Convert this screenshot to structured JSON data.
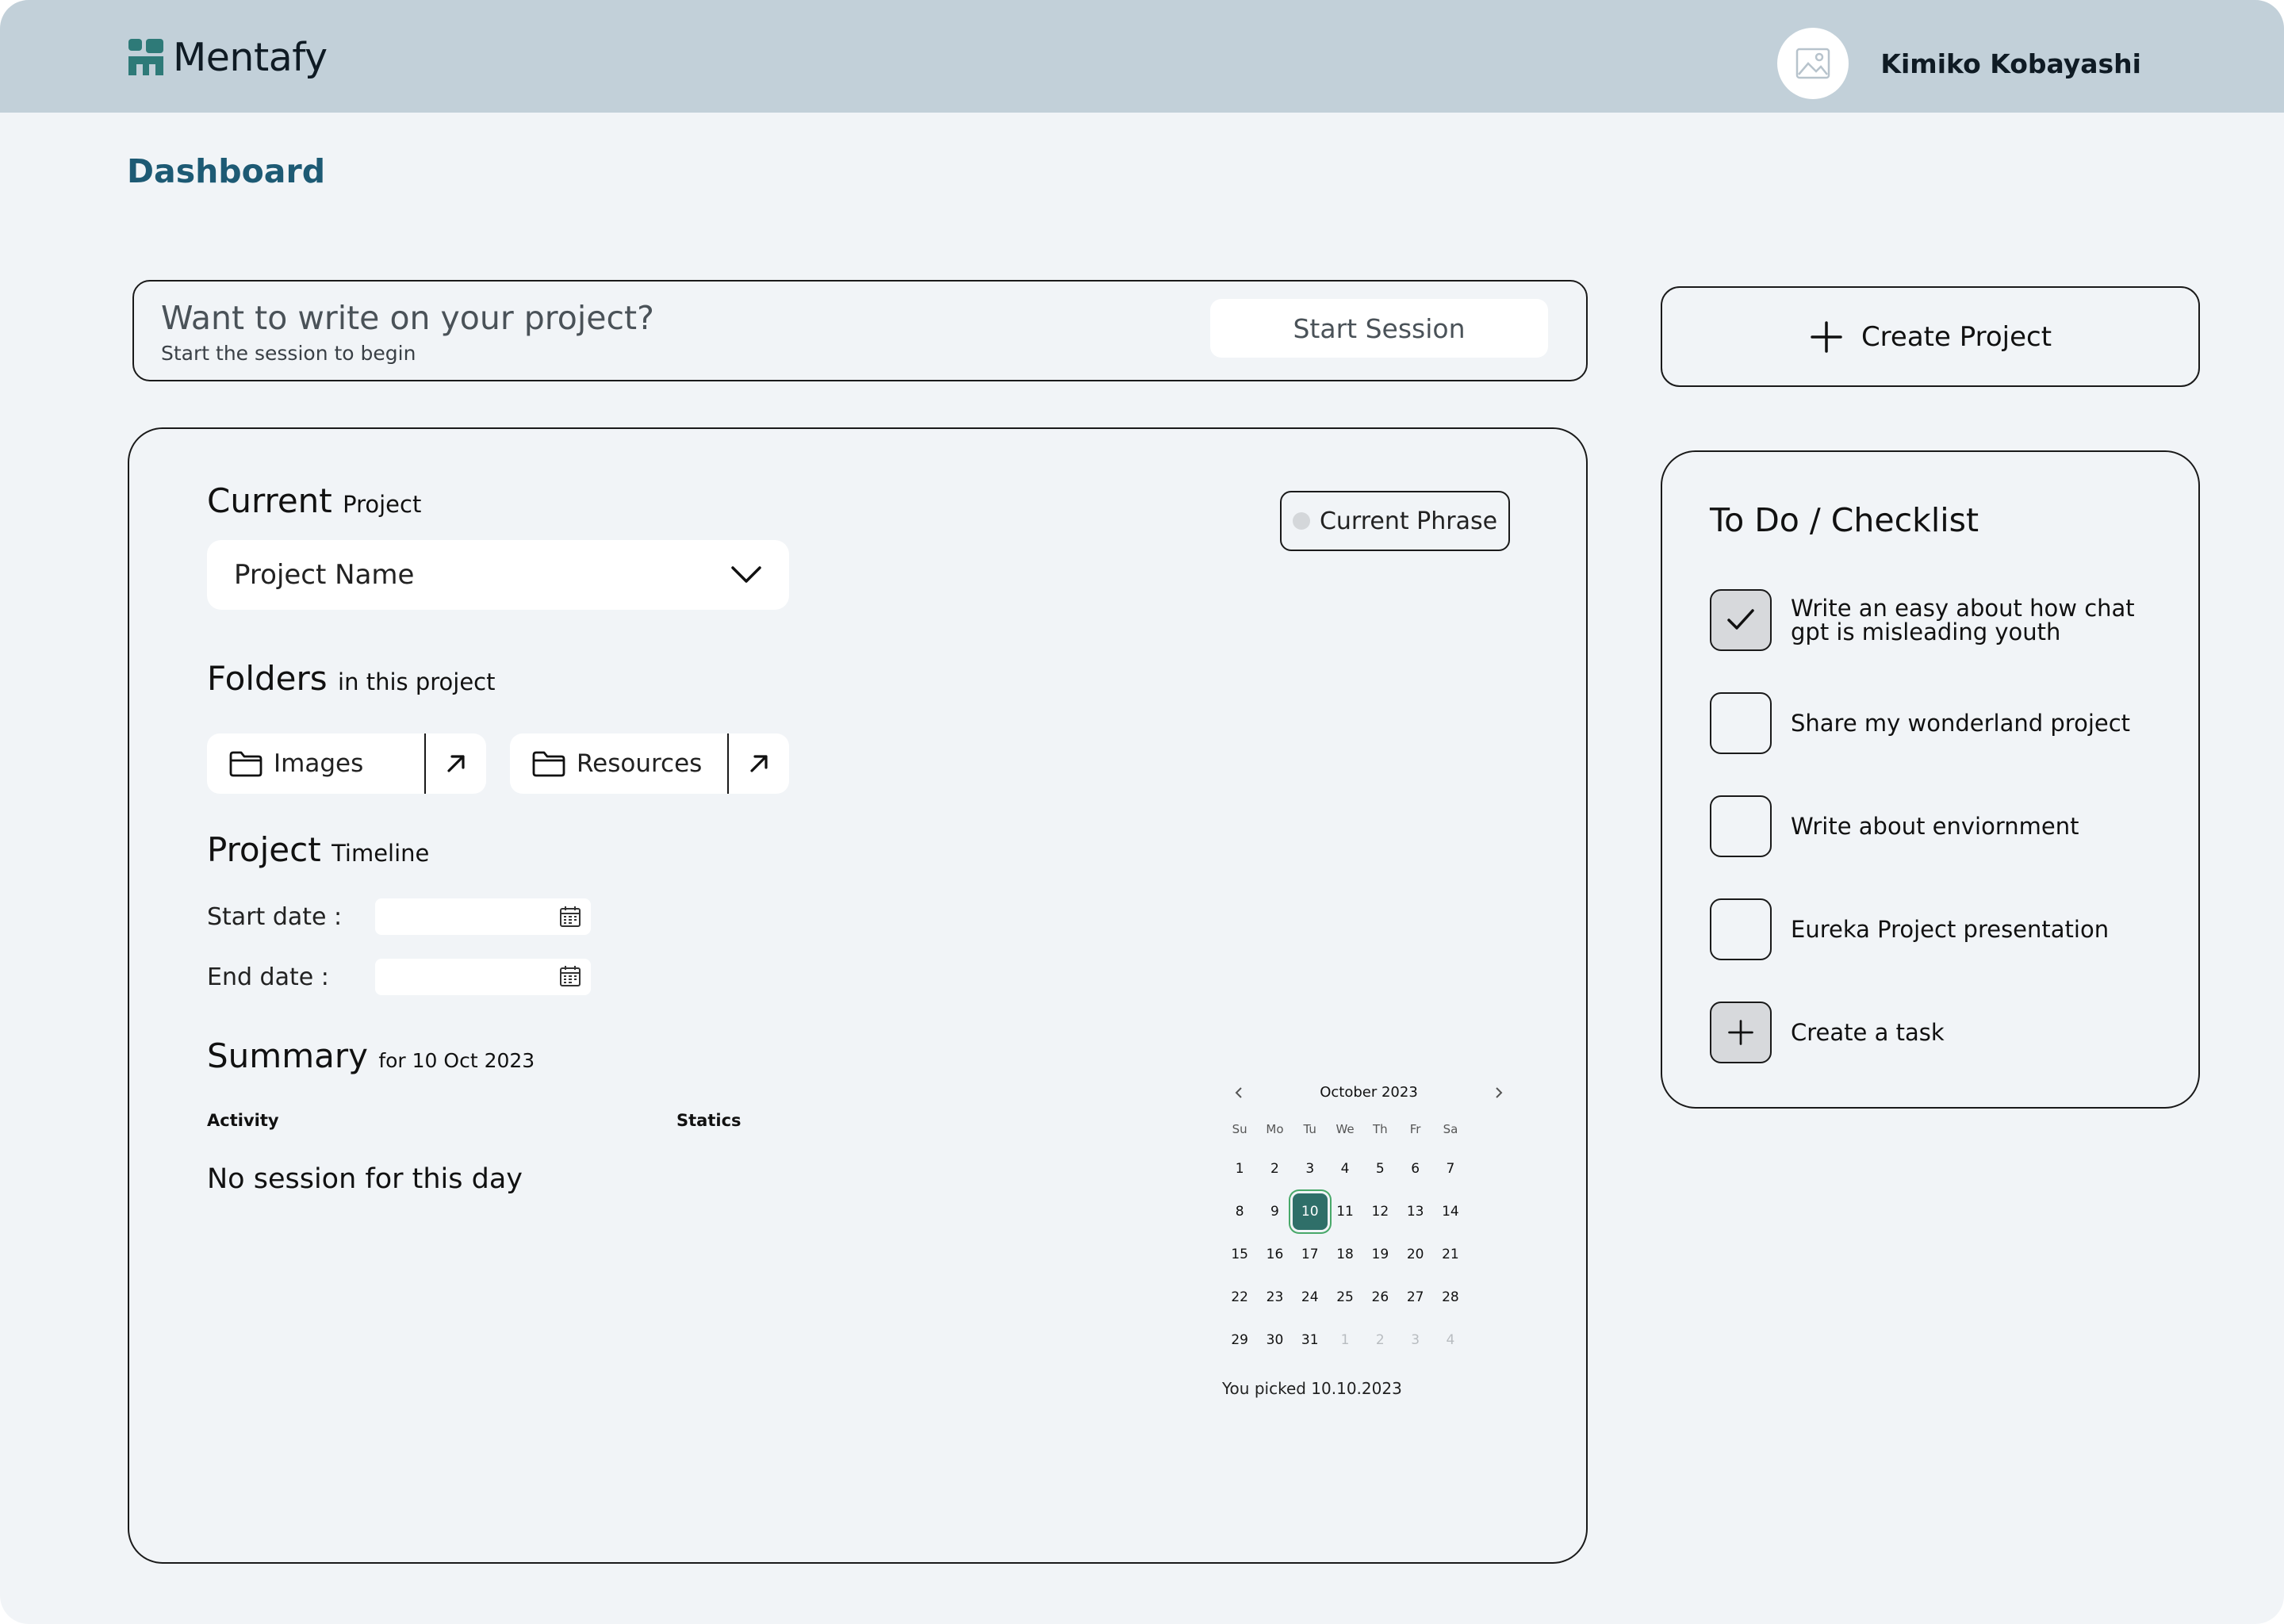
{
  "app": {
    "name": "Mentafy"
  },
  "user": {
    "name": "Kimiko Kobayashi",
    "avatar_icon": "image-placeholder-icon"
  },
  "page": {
    "title": "Dashboard"
  },
  "session": {
    "title": "Want to write on your project?",
    "subtitle": "Start the session to begin",
    "start_label": "Start Session"
  },
  "create_project": {
    "label": "Create Project",
    "icon": "plus-icon"
  },
  "current_project": {
    "heading": "Current",
    "heading_small": "Project",
    "selected": "Project Name",
    "phrase_label": "Current Phrase"
  },
  "folders": {
    "heading": "Folders",
    "heading_small": "in this project",
    "items": [
      {
        "label": "Images",
        "icon": "folder-icon"
      },
      {
        "label": "Resources",
        "icon": "folder-icon"
      }
    ]
  },
  "timeline": {
    "heading": "Project",
    "heading_small": "Timeline",
    "start_label": "Start date :",
    "end_label": "End date   :",
    "start_value": "",
    "end_value": ""
  },
  "summary": {
    "heading": "Summary",
    "heading_small": "for 10 Oct 2023",
    "col_activity": "Activity",
    "col_statics": "Statics",
    "empty_message": "No session for this day"
  },
  "calendar": {
    "month_label": "October 2023",
    "weekdays": [
      "Su",
      "Mo",
      "Tu",
      "We",
      "Th",
      "Fr",
      "Sa"
    ],
    "days": [
      {
        "d": "1"
      },
      {
        "d": "2"
      },
      {
        "d": "3"
      },
      {
        "d": "4"
      },
      {
        "d": "5"
      },
      {
        "d": "6"
      },
      {
        "d": "7"
      },
      {
        "d": "8"
      },
      {
        "d": "9"
      },
      {
        "d": "10",
        "selected": true
      },
      {
        "d": "11"
      },
      {
        "d": "12"
      },
      {
        "d": "13"
      },
      {
        "d": "14"
      },
      {
        "d": "15"
      },
      {
        "d": "16"
      },
      {
        "d": "17"
      },
      {
        "d": "18"
      },
      {
        "d": "19"
      },
      {
        "d": "20"
      },
      {
        "d": "21"
      },
      {
        "d": "22"
      },
      {
        "d": "23"
      },
      {
        "d": "24"
      },
      {
        "d": "25"
      },
      {
        "d": "26"
      },
      {
        "d": "27"
      },
      {
        "d": "28"
      },
      {
        "d": "29"
      },
      {
        "d": "30"
      },
      {
        "d": "31"
      },
      {
        "d": "1",
        "muted": true
      },
      {
        "d": "2",
        "muted": true
      },
      {
        "d": "3",
        "muted": true
      },
      {
        "d": "4",
        "muted": true
      }
    ],
    "picked_text": "You picked 10.10.2023"
  },
  "todo": {
    "title": "To Do / Checklist",
    "items": [
      {
        "label": "Write an easy about how chat gpt is misleading youth",
        "checked": true
      },
      {
        "label": "Share my wonderland project",
        "checked": false
      },
      {
        "label": "Write about enviornment",
        "checked": false
      },
      {
        "label": "Eureka Project presentation",
        "checked": false
      }
    ],
    "create_label": "Create a task"
  },
  "colors": {
    "topbar": "#c2d0d9",
    "background": "#f1f4f7",
    "title_accent": "#1d5a74",
    "calendar_selected": "#2f6f69",
    "calendar_ring": "#48a869",
    "logo": "#2e7a78"
  }
}
